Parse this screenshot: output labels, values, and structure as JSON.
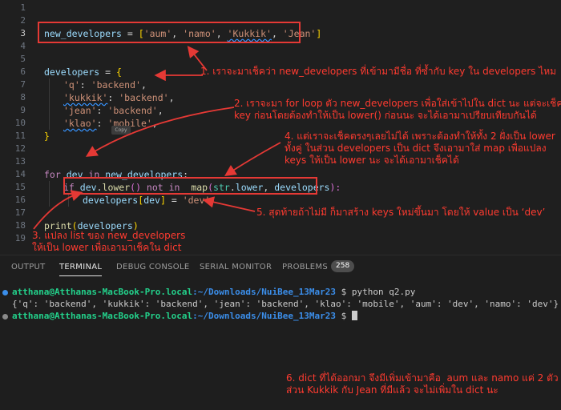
{
  "editor": {
    "line_numbers": [
      "1",
      "2",
      "3",
      "4",
      "5",
      "6",
      "7",
      "8",
      "9",
      "10",
      "11",
      "12",
      "13",
      "14",
      "15",
      "16",
      "17",
      "18",
      "19"
    ],
    "active_line": "3",
    "code": {
      "l3": {
        "var": "new_developers",
        "op": " = ",
        "ob": "[",
        "s1": "'aum'",
        "c1": ", ",
        "s2": "'namo'",
        "c2": ", ",
        "s3": "'Kukkik'",
        "c3": ", ",
        "s4": "'Jean'",
        "cb": "]"
      },
      "l5": {
        "var": "developers",
        "op": " = ",
        "ob": "{"
      },
      "l6": {
        "key": "'q'",
        "colon": ": ",
        "val": "'backend'",
        "comma": ","
      },
      "l7": {
        "key": "'kukkik'",
        "colon": ": ",
        "val": "'backend'",
        "comma": ","
      },
      "l8": {
        "key": "'jean'",
        "colon": ": ",
        "val": "'backend'",
        "comma": ","
      },
      "l9": {
        "key": "'klao'",
        "colon": ": ",
        "val": "'mobile'",
        "comma": ","
      },
      "l10": {
        "cb": "}"
      },
      "l13": {
        "kw": "for",
        "v1": "dev",
        "in": " in ",
        "v2": "new_developers",
        "colon": ":"
      },
      "l14": {
        "kw": "if",
        "v1": "dev",
        "dot": ".",
        "fn": "lower",
        "paren": "()",
        "not": " not in ",
        "fn2": "map",
        "op": "(",
        "cls": "str",
        "dot2": ".",
        "attr": "lower",
        "comma": ", ",
        "v2": "developers",
        "cp": "):"
      },
      "l15": {
        "v1": "developers",
        "ob": "[",
        "v2": "dev",
        "cb": "]",
        "op": " = ",
        "s": "'dev'"
      },
      "l17": {
        "fn": "print",
        "op": "(",
        "v": "developers",
        "cp": ")"
      }
    },
    "copy_tooltip": "Copy"
  },
  "annotations": {
    "n1": "1. เราจะมาเช็คว่า new_developers ที่เข้ามามีชื่อ ที่ซ้ำกับ key ใน developers ไหม",
    "n2": "2. เราจะมา for loop ตัว new_developers เพื่อใส่เข้าไปใน dict นะ แต่จะเช็ค\nkey ก่อนโดยต้องทำให้เป็น lower() ก่อนนะ จะได้เอามาเปรียบเทียบกันได้",
    "n3": "3. แปลง list ของ new_developers\nให้เป็น lower เพื่อเอามาเช็คใน dict",
    "n4": "4. แต่เราจะเช็คตรงๆเลยไม่ได้ เพราะต้องทำให้ทั้ง 2 ฝั่งเป็น lower\nทั้งคู่ ในส่วน developers เป็น dict จึงเอามาใส่ map เพื่อแปลง\nkeys ให้เป็น lower นะ จะได้เอามาเช็คได้",
    "n5": "5. สุดท้ายถ้าไม่มี ก็มาสร้าง keys ใหม่ขึ้นมา โดยให้ value เป็น ‘dev’",
    "n6": "6. dict ที่ได้ออกมา จึงมีเพิ่มเข้ามาคือ  aum และ namo แค่ 2 ตัว\nส่วน Kukkik กับ Jean ที่มีแล้ว จะไม่เพิ่มใน dict นะ"
  },
  "panel": {
    "tabs": [
      "OUTPUT",
      "TERMINAL",
      "DEBUG CONSOLE",
      "SERIAL MONITOR",
      "PROBLEMS"
    ],
    "active_tab": "TERMINAL",
    "problems_count": "258"
  },
  "terminal": {
    "user_host": "atthana@Atthanas-MacBook-Pro.local",
    "path": ":~/Downloads/NuiBee_13Mar23",
    "prompt": " $ ",
    "command": "python q2.py",
    "output_main": "{'q': 'backend', 'kukkik': 'backend', 'jean': 'backend', 'klao': 'mobile', ",
    "output_added": "'aum': 'dev', 'namo': 'dev'}"
  },
  "colors": {
    "accent_red": "#e53935",
    "terminal_green": "#23d18b",
    "terminal_blue": "#3b8eea"
  }
}
